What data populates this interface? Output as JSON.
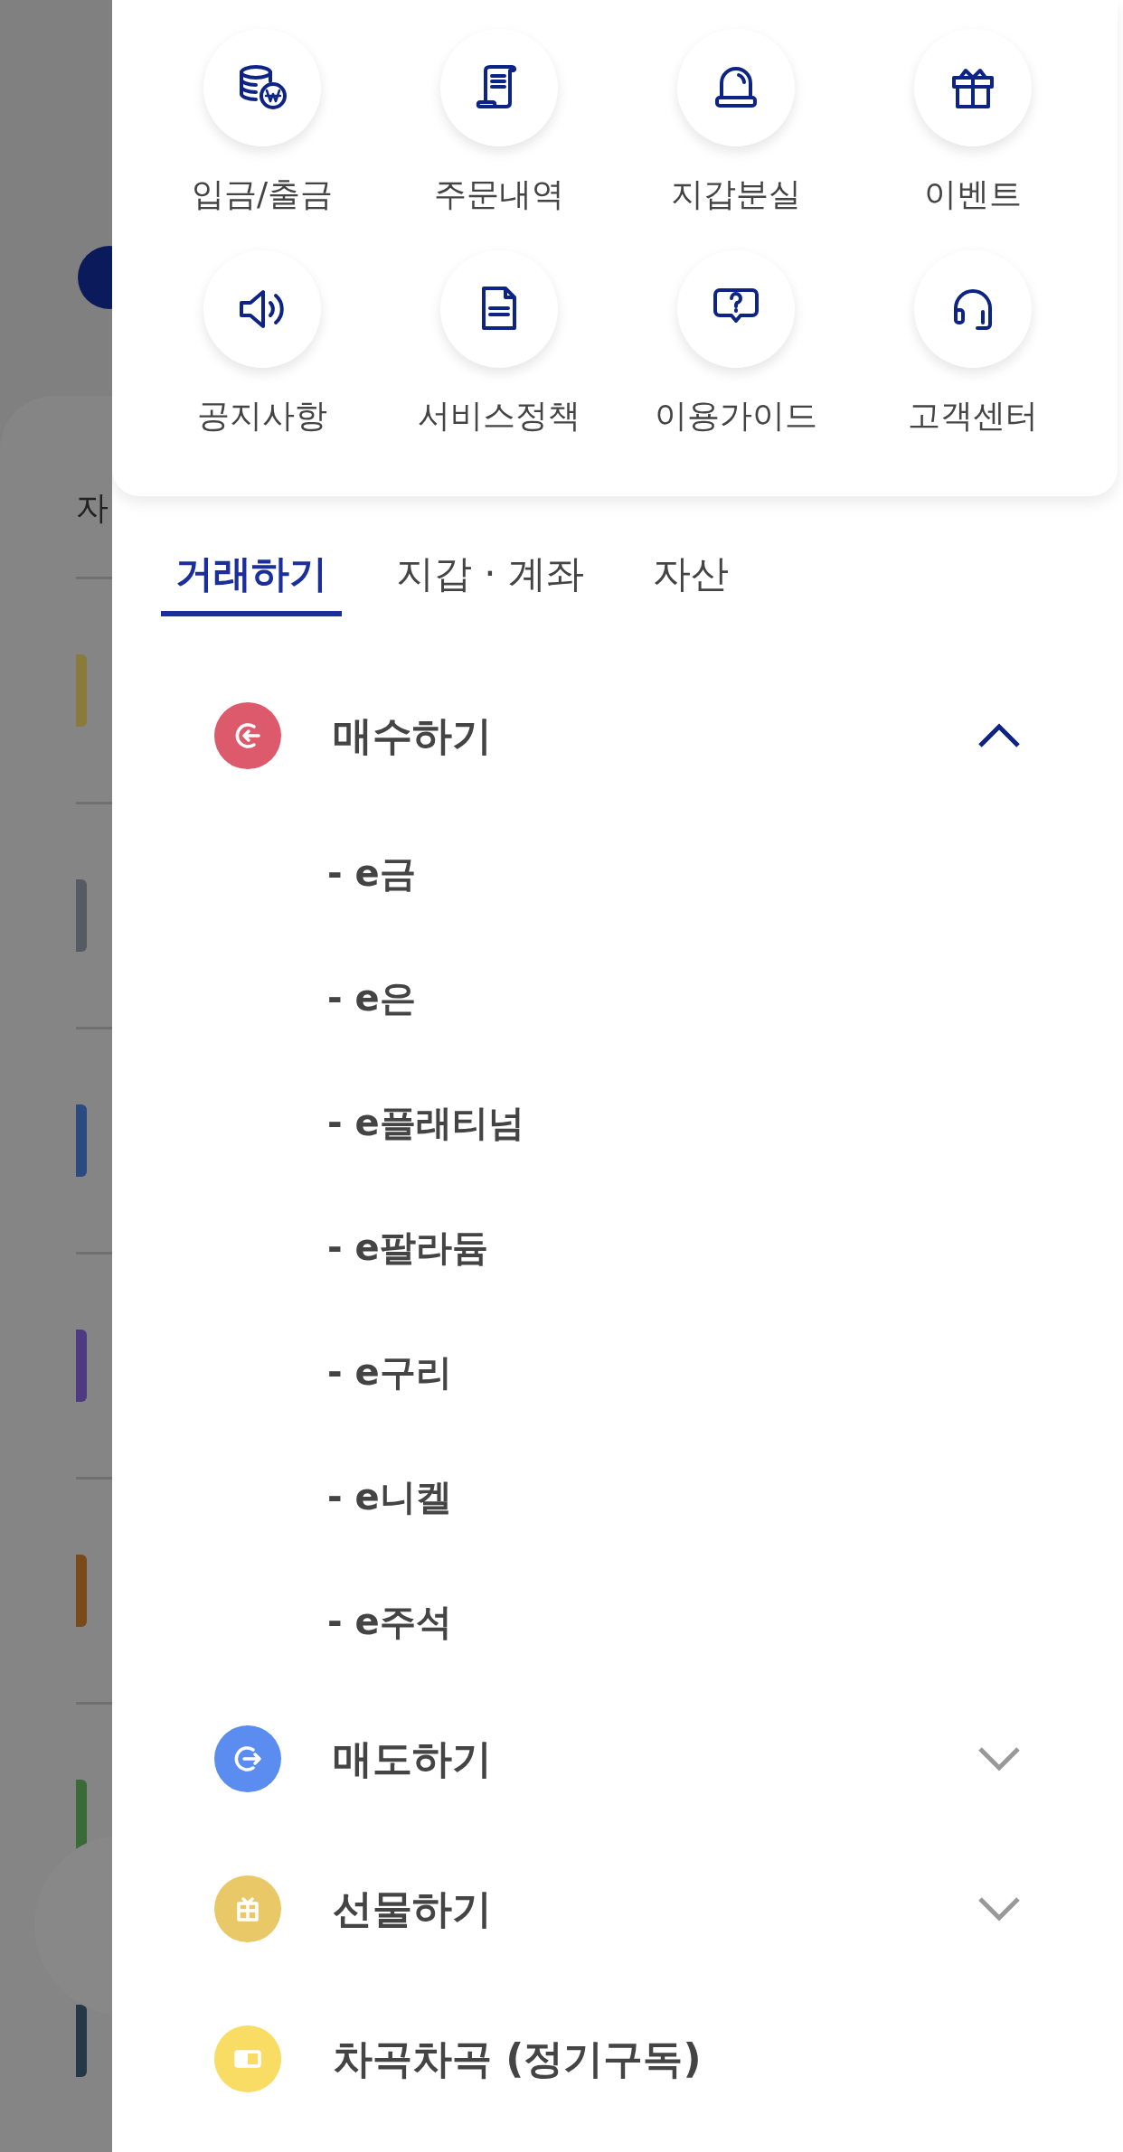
{
  "background": {
    "label": "자",
    "rows": [
      {
        "color": "#8a7a3c"
      },
      {
        "color": "#555a63"
      },
      {
        "color": "#2a4a80"
      },
      {
        "color": "#4e3a80"
      },
      {
        "color": "#7a4a18"
      },
      {
        "color": "#3a6a38"
      },
      {
        "color": "#253848"
      }
    ]
  },
  "quick_menu": [
    {
      "kind": "deposit",
      "label": "입금/출금"
    },
    {
      "kind": "orders",
      "label": "주문내역"
    },
    {
      "kind": "lost-wallet",
      "label": "지갑분실"
    },
    {
      "kind": "event",
      "label": "이벤트"
    },
    {
      "kind": "notice",
      "label": "공지사항"
    },
    {
      "kind": "policy",
      "label": "서비스정책"
    },
    {
      "kind": "guide",
      "label": "이용가이드"
    },
    {
      "kind": "support",
      "label": "고객센터"
    }
  ],
  "tabs": [
    {
      "label": "거래하기",
      "selected": true
    },
    {
      "label": "지갑 · 계좌",
      "selected": false
    },
    {
      "label": "자산",
      "selected": false
    }
  ],
  "menu": [
    {
      "kind": "buy",
      "label": "매수하기",
      "color": "#dc5a6c",
      "expanded": true,
      "children": [
        {
          "label": "- e금"
        },
        {
          "label": "- e은"
        },
        {
          "label": "- e플래티넘"
        },
        {
          "label": "- e팔라듐"
        },
        {
          "label": "- e구리"
        },
        {
          "label": "- e니켈"
        },
        {
          "label": "- e주석"
        }
      ]
    },
    {
      "kind": "sell",
      "label": "매도하기",
      "color": "#5b8cf0",
      "expanded": false
    },
    {
      "kind": "gift",
      "label": "선물하기",
      "color": "#e8c867",
      "expanded": false
    },
    {
      "kind": "subscription",
      "label": "차곡차곡 (정기구독)",
      "color": "#f8dc64"
    }
  ]
}
